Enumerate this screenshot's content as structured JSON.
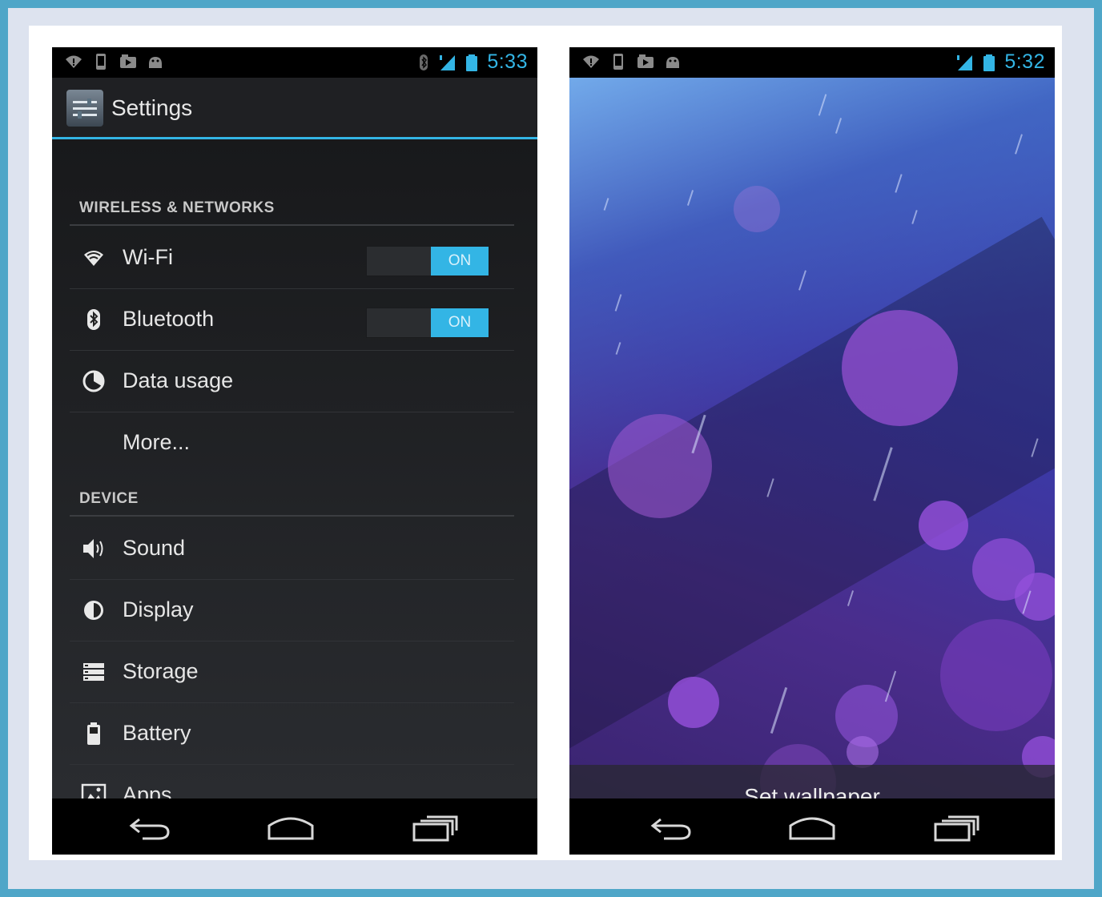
{
  "colors": {
    "accent": "#33b5e5",
    "background": "#dde3ef",
    "border": "#4fa6c8"
  },
  "left_phone": {
    "status_bar": {
      "left_icons": [
        "wifi-alert-icon",
        "phone-icon",
        "video-icon",
        "android-icon"
      ],
      "right_icons": [
        "bluetooth-icon",
        "signal-icon",
        "battery-icon"
      ],
      "time": "5:33"
    },
    "action_bar": {
      "icon": "settings-app-icon",
      "title": "Settings"
    },
    "sections": [
      {
        "header": "WIRELESS & NETWORKS",
        "items": [
          {
            "label": "Wi-Fi",
            "icon": "wifi-icon",
            "toggle": "ON"
          },
          {
            "label": "Bluetooth",
            "icon": "bluetooth-icon",
            "toggle": "ON"
          },
          {
            "label": "Data usage",
            "icon": "data-usage-icon"
          },
          {
            "label": "More..."
          }
        ]
      },
      {
        "header": "DEVICE",
        "items": [
          {
            "label": "Sound",
            "icon": "speaker-icon"
          },
          {
            "label": "Display",
            "icon": "display-brightness-icon"
          },
          {
            "label": "Storage",
            "icon": "storage-icon"
          },
          {
            "label": "Battery",
            "icon": "battery-icon"
          },
          {
            "label": "Apps",
            "icon": "apps-icon"
          }
        ]
      }
    ],
    "nav_bar": [
      "back-icon",
      "home-icon",
      "recent-apps-icon"
    ]
  },
  "right_phone": {
    "status_bar": {
      "left_icons": [
        "wifi-alert-icon",
        "phone-icon",
        "video-icon",
        "android-icon"
      ],
      "right_icons": [
        "signal-icon",
        "battery-icon"
      ],
      "time": "5:32"
    },
    "set_wallpaper_label": "Set wallpaper",
    "nav_bar": [
      "back-icon",
      "home-icon",
      "recent-apps-icon"
    ]
  }
}
